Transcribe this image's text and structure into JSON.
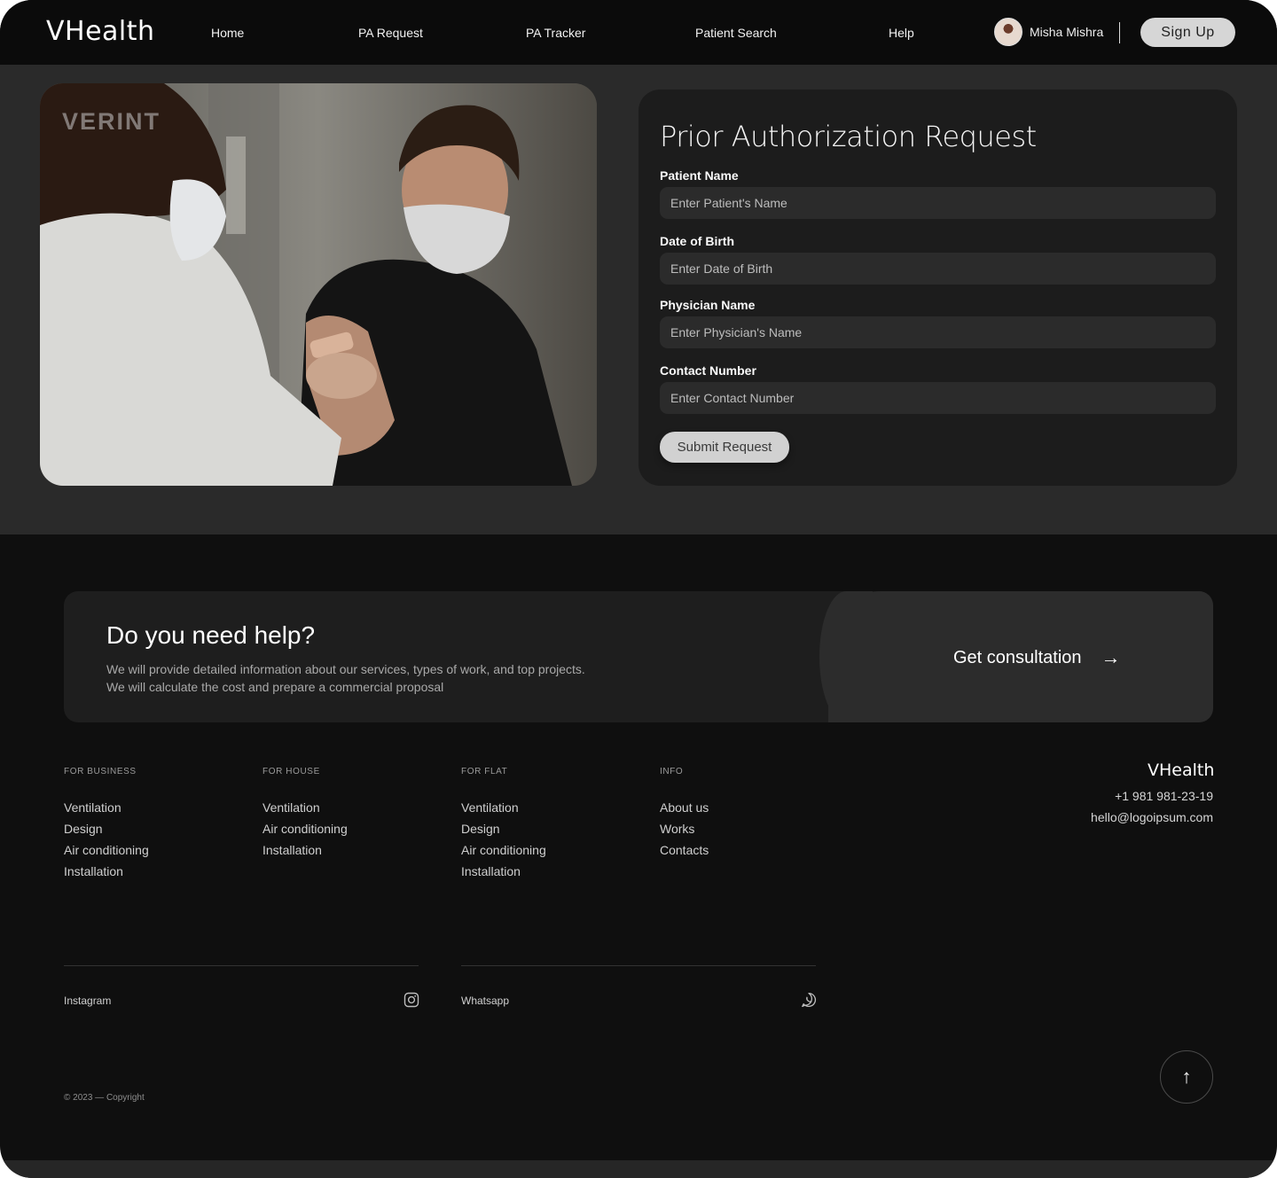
{
  "header": {
    "logo": "VHealth",
    "nav": [
      "Home",
      "PA Request",
      "PA Tracker",
      "Patient Search",
      "Help"
    ],
    "user_name": "Misha Mishra",
    "signup_label": "Sign Up"
  },
  "hero": {
    "watermark": "VERINT"
  },
  "form": {
    "title": "Prior Authorization Request",
    "fields": [
      {
        "label": "Patient Name",
        "placeholder": "Enter Patient's Name"
      },
      {
        "label": "Date of Birth",
        "placeholder": "Enter Date of Birth"
      },
      {
        "label": "Physician Name",
        "placeholder": "Enter Physician's Name"
      },
      {
        "label": "Contact Number",
        "placeholder": "Enter Contact Number"
      }
    ],
    "submit_label": "Submit Request"
  },
  "help": {
    "title": "Do you need help?",
    "line1": "We will provide detailed information about our services, types of work, and top projects.",
    "line2": "We will calculate the cost and prepare a commercial proposal",
    "cta": "Get consultation",
    "cta_arrow": "→"
  },
  "footer": {
    "columns": [
      {
        "title": "FOR BUSINESS",
        "links": [
          "Ventilation",
          "Design",
          "Air conditioning",
          "Installation"
        ]
      },
      {
        "title": "FOR HOUSE",
        "links": [
          "Ventilation",
          "Air conditioning",
          "Installation"
        ]
      },
      {
        "title": "FOR FLAT",
        "links": [
          "Ventilation",
          "Design",
          "Air conditioning",
          "Installation"
        ]
      },
      {
        "title": "INFO",
        "links": [
          "About us",
          "Works",
          "Contacts"
        ]
      }
    ],
    "logo": "VHealth",
    "phone": "+1 981 981-23-19",
    "email": "hello@logoipsum.com",
    "social": [
      "Instagram",
      "Whatsapp"
    ],
    "copyright": "© 2023 — Copyright",
    "to_top_arrow": "↑"
  },
  "colors": {
    "background": "#0f0f0f",
    "hero_background": "#2a2a2a",
    "card": "#1c1c1c",
    "input": "#2b2b2b",
    "button": "#d1d1d1"
  },
  "icons": [
    "instagram-icon",
    "whatsapp-icon",
    "arrow-right-icon",
    "arrow-up-icon"
  ]
}
